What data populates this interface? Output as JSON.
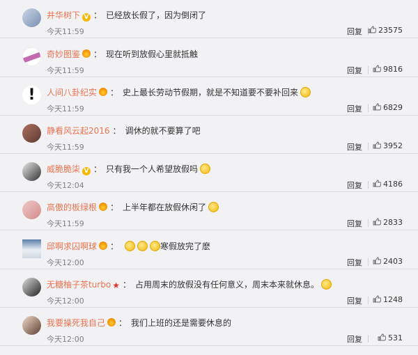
{
  "comments": [
    {
      "username": "井华树下",
      "badge": "v",
      "text": "已经放长假了，因为倒闭了",
      "time": "今天11:59",
      "reply": "回复",
      "likes": "23575",
      "avatar": "a1"
    },
    {
      "username": "奇妙图鉴",
      "badge": "crown",
      "text": "现在听到放假心里就抵触",
      "time": "今天11:59",
      "reply": "回复",
      "likes": "9816",
      "avatar": "a2"
    },
    {
      "username": "人间八卦纪实",
      "badge": "crown",
      "text": "史上最长劳动节假期，就是不知道要不要补回来",
      "emoji_after": 1,
      "time": "今天11:59",
      "reply": "回复",
      "likes": "6829",
      "avatar": "a3"
    },
    {
      "username": "静看风云起2016",
      "badge": "none",
      "text": "调休的就不要算了吧",
      "time": "今天11:59",
      "reply": "回复",
      "likes": "3952",
      "avatar": "a4"
    },
    {
      "username": "威脆脆柒",
      "badge": "v",
      "text": "只有我一个人希望放假吗",
      "emoji_after": 1,
      "time": "今天12:04",
      "reply": "回复",
      "likes": "4186",
      "avatar": "a5"
    },
    {
      "username": "高傲的板绿根",
      "badge": "crown",
      "text": "上半年都在放假休闲了",
      "emoji_after": 1,
      "time": "今天11:59",
      "reply": "回复",
      "likes": "2833",
      "avatar": "a6"
    },
    {
      "username": "邱啊求囚啊球",
      "badge": "crown",
      "text": "寒假放完了麽",
      "emoji_before": 3,
      "time": "今天12:00",
      "reply": "回复",
      "likes": "2403",
      "avatar": "a7"
    },
    {
      "username": "无糖柚子茶turbo",
      "badge": "star",
      "text": "占用周末的放假没有任何意义，周末本来就休息。",
      "emoji_after": 1,
      "time": "今天12:00",
      "reply": "回复",
      "likes": "1248",
      "avatar": "a8"
    },
    {
      "username": "我要操死我自己",
      "badge": "crown",
      "text": "我们上班的还是需要休息的",
      "time": "今天12:00",
      "reply": "回复",
      "likes": "531",
      "avatar": "a9"
    }
  ],
  "colors": {
    "username": "#eb7350",
    "text": "#333333",
    "time": "#808080",
    "background": "#f2f2f5"
  },
  "icons": {
    "like": "thumbs-up-icon",
    "reply": "reply-link"
  }
}
